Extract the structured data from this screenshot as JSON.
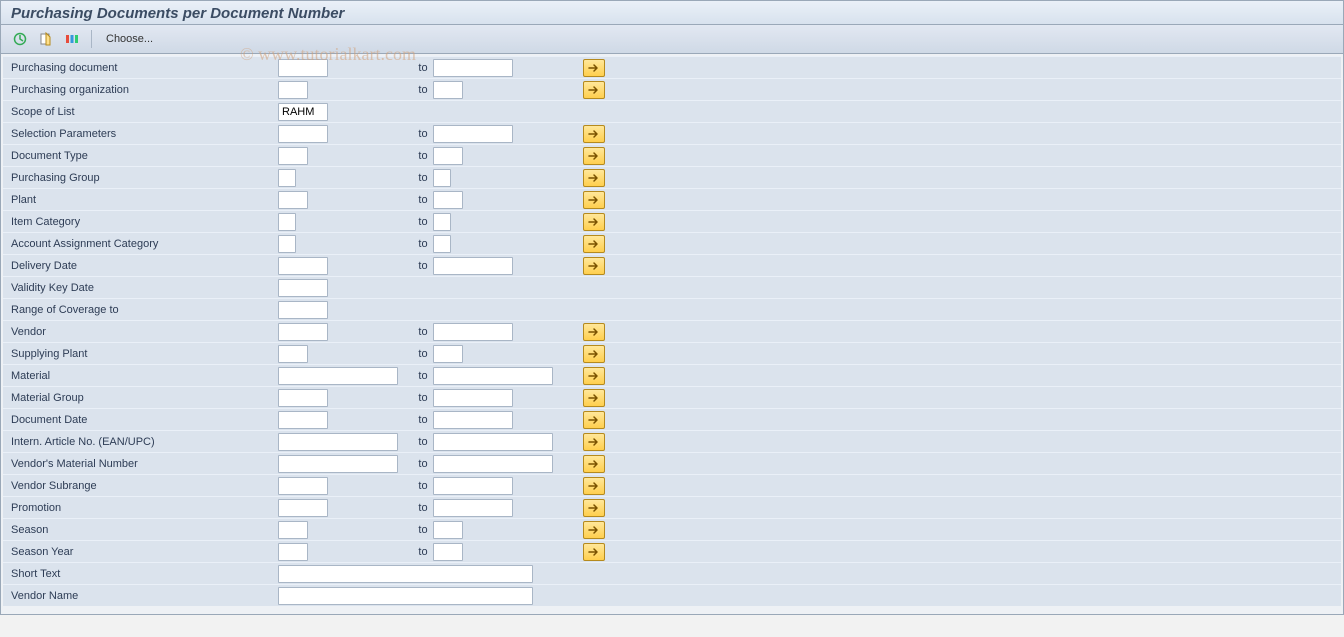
{
  "window": {
    "title": "Purchasing Documents per Document Number"
  },
  "toolbar": {
    "choose_label": "Choose..."
  },
  "watermark": "© www.tutorialkart.com",
  "to_label": "to",
  "rows": [
    {
      "id": "purch-doc",
      "label": "Purchasing document",
      "from_w": "w50",
      "to_w": "w80",
      "more": true
    },
    {
      "id": "purch-org",
      "label": "Purchasing organization",
      "from_w": "w30",
      "to_w": "w30",
      "more": true
    },
    {
      "id": "scope-list",
      "label": "Scope of List",
      "from_w": "w50",
      "value_from": "RAHM",
      "to_w": null,
      "more": false
    },
    {
      "id": "sel-params",
      "label": "Selection Parameters",
      "from_w": "w50",
      "to_w": "w80",
      "more": true
    },
    {
      "id": "doc-type",
      "label": "Document Type",
      "from_w": "w30",
      "to_w": "w30",
      "more": true
    },
    {
      "id": "purch-group",
      "label": "Purchasing Group",
      "from_w": "w20",
      "to_w": "w20",
      "more": true
    },
    {
      "id": "plant",
      "label": "Plant",
      "from_w": "w30",
      "to_w": "w30",
      "more": true
    },
    {
      "id": "item-category",
      "label": "Item Category",
      "from_w": "w20",
      "to_w": "w20",
      "more": true
    },
    {
      "id": "acct-assign-cat",
      "label": "Account Assignment Category",
      "from_w": "w20",
      "to_w": "w20",
      "more": true
    },
    {
      "id": "delivery-date",
      "label": "Delivery Date",
      "from_w": "w50",
      "to_w": "w80",
      "more": true
    },
    {
      "id": "validity-key-date",
      "label": "Validity Key Date",
      "from_w": "w50",
      "to_w": null,
      "more": false
    },
    {
      "id": "range-coverage",
      "label": "Range of Coverage to",
      "from_w": "w50",
      "to_w": null,
      "more": false
    },
    {
      "id": "vendor",
      "label": "Vendor",
      "from_w": "w50",
      "to_w": "w80",
      "more": true
    },
    {
      "id": "supplying-plant",
      "label": "Supplying Plant",
      "from_w": "w30",
      "to_w": "w30",
      "more": true
    },
    {
      "id": "material",
      "label": "Material",
      "from_w": "w120",
      "to_w": "w120",
      "more": true,
      "wide": true
    },
    {
      "id": "material-group",
      "label": "Material Group",
      "from_w": "w50",
      "to_w": "w80",
      "more": true
    },
    {
      "id": "doc-date",
      "label": "Document Date",
      "from_w": "w50",
      "to_w": "w80",
      "more": true
    },
    {
      "id": "ean-upc",
      "label": "Intern. Article No. (EAN/UPC)",
      "from_w": "w120",
      "to_w": "w120",
      "more": true,
      "wide": true
    },
    {
      "id": "vendor-mat-no",
      "label": "Vendor's Material Number",
      "from_w": "w120",
      "to_w": "w120",
      "more": true,
      "wide": true
    },
    {
      "id": "vendor-subrange",
      "label": "Vendor Subrange",
      "from_w": "w50",
      "to_w": "w80",
      "more": true
    },
    {
      "id": "promotion",
      "label": "Promotion",
      "from_w": "w50",
      "to_w": "w80",
      "more": true
    },
    {
      "id": "season",
      "label": "Season",
      "from_w": "w30",
      "to_w": "w30",
      "more": true
    },
    {
      "id": "season-year",
      "label": "Season Year",
      "from_w": "w30",
      "to_w": "w30",
      "more": true
    },
    {
      "id": "short-text",
      "label": "Short Text",
      "from_w": "w250",
      "to_w": null,
      "more": false
    },
    {
      "id": "vendor-name",
      "label": "Vendor Name",
      "from_w": "w250",
      "to_w": null,
      "more": false
    }
  ]
}
